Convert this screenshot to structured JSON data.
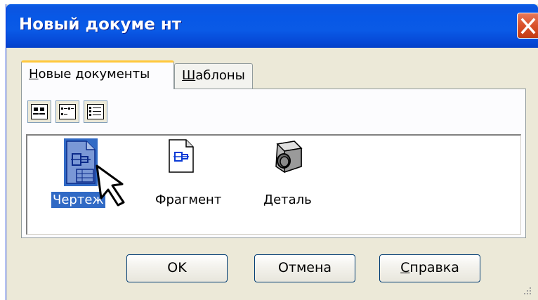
{
  "window": {
    "title": "Новый докуме нт"
  },
  "tabs": [
    {
      "label": "Новые документы",
      "accel": "Н",
      "rest": "овые документы",
      "active": true
    },
    {
      "label": "Шаблоны",
      "accel": "Ш",
      "rest": "аблоны",
      "active": false
    }
  ],
  "view_buttons": [
    {
      "icon": "large-icons-view-icon"
    },
    {
      "icon": "small-icons-view-icon"
    },
    {
      "icon": "details-view-icon"
    }
  ],
  "documents": [
    {
      "label": "Чертеж",
      "icon": "drawing-icon",
      "selected": true
    },
    {
      "label": "Фрагмент",
      "icon": "fragment-icon",
      "selected": false
    },
    {
      "label": "Деталь",
      "icon": "part-icon",
      "selected": false
    }
  ],
  "buttons": {
    "ok": "OK",
    "cancel": "Отмена",
    "help_accel": "С",
    "help_rest": "правка"
  },
  "colors": {
    "titlebar": "#0a5ae6",
    "selection": "#316ac5",
    "tab_highlight": "#ffc83c",
    "close": "#d9502a"
  }
}
